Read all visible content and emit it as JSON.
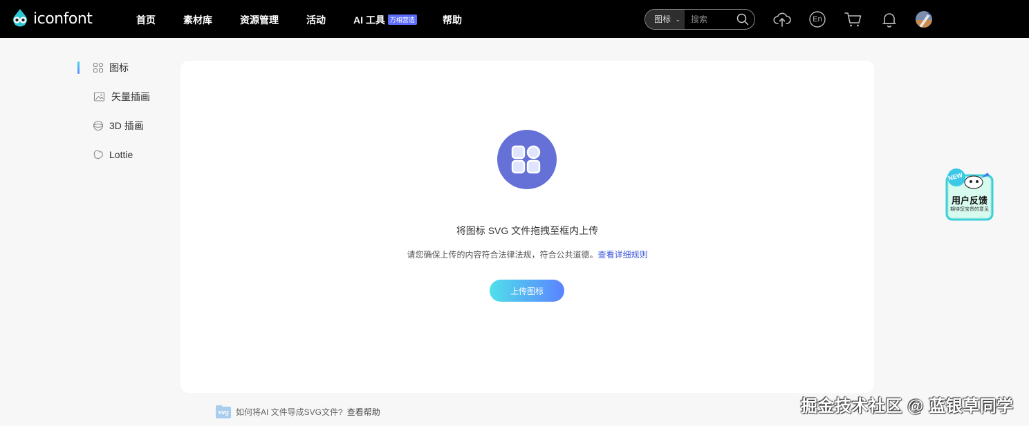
{
  "header": {
    "brand": "iconfont",
    "nav": [
      {
        "label": "首页"
      },
      {
        "label": "素材库"
      },
      {
        "label": "资源管理"
      },
      {
        "label": "活动"
      },
      {
        "label": "AI 工具",
        "badge": "万相营造"
      },
      {
        "label": "帮助"
      }
    ],
    "search": {
      "type": "图标",
      "placeholder": "搜索"
    },
    "icons": [
      "upload-cloud-icon",
      "language-en-icon",
      "cart-icon",
      "bell-icon",
      "user-avatar"
    ],
    "lang_label": "En"
  },
  "sidebar": {
    "items": [
      {
        "label": "图标",
        "icon": "grid-icon",
        "active": true
      },
      {
        "label": "矢量插画",
        "icon": "image-icon"
      },
      {
        "label": "3D 插画",
        "icon": "sphere-icon"
      },
      {
        "label": "Lottie",
        "icon": "lottie-icon"
      }
    ]
  },
  "upload": {
    "title": "将图标 SVG 文件拖拽至框内上传",
    "notice": "请您确保上传的内容符合法律法规，符合公共道德。",
    "rules_link": "查看详细规则",
    "button": "上传图标"
  },
  "help": {
    "tag": "svg",
    "question": "如何将AI 文件导成SVG文件?",
    "link": "查看帮助"
  },
  "feedback": {
    "badge": "NEW",
    "title": "用户反馈",
    "subtitle": "期待您宝贵的意见"
  },
  "watermark": "掘金技术社区 @ 蓝银草同学",
  "colors": {
    "accent": "#6571d6",
    "link": "#3a55d9",
    "button_gradient_start": "#4fe0ea",
    "button_gradient_end": "#5c82ff",
    "topbar": "#000000"
  }
}
